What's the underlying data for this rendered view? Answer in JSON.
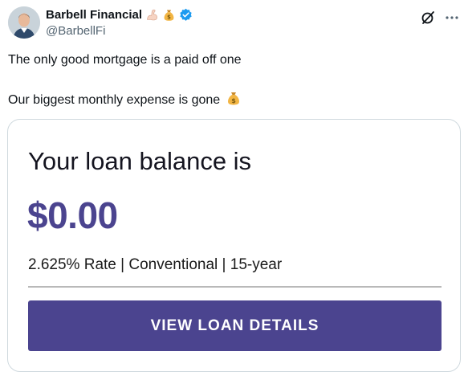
{
  "author": {
    "display_name": "Barbell Financial",
    "handle": "@BarbellFi",
    "name_emojis": [
      "flexed-biceps-emoji",
      "money-bag-emoji"
    ],
    "verified": true
  },
  "tweet": {
    "line1": "The only good mortgage is a paid off one",
    "line2": "Our biggest monthly expense is gone"
  },
  "card": {
    "heading": "Your loan balance is",
    "amount": "$0.00",
    "terms": "2.625% Rate | Conventional | 15-year",
    "button_label": "VIEW LOAN DETAILS"
  },
  "icons": {
    "grok": "grok-icon",
    "more": "more-icon",
    "verified": "verified-badge-icon"
  },
  "colors": {
    "brand_purple": "#4b448f",
    "verified_blue": "#1d9bf0",
    "text_primary": "#0f1419",
    "text_secondary": "#536471",
    "card_border": "#cfd9de"
  }
}
